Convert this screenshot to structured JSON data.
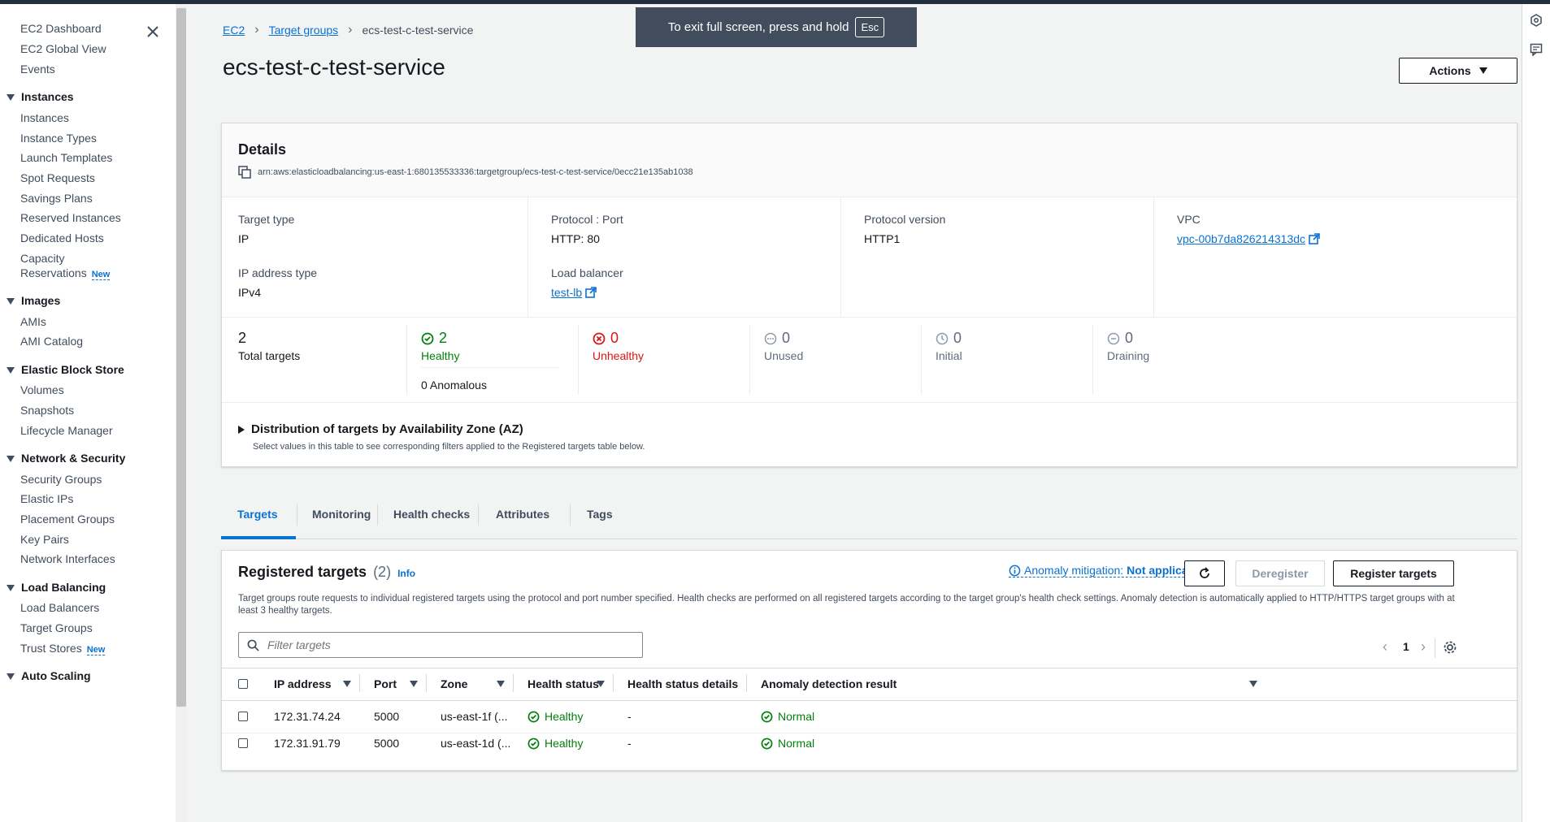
{
  "fullscreen_toast": {
    "text": "To exit full screen, press and hold",
    "key": "Esc"
  },
  "sidebar": {
    "top_items": [
      "EC2 Dashboard",
      "EC2 Global View",
      "Events"
    ],
    "sections": [
      {
        "title": "Instances",
        "items": [
          "Instances",
          "Instance Types",
          "Launch Templates",
          "Spot Requests",
          "Savings Plans",
          "Reserved Instances",
          "Dedicated Hosts",
          "Capacity",
          "Reservations"
        ]
      },
      {
        "title": "Images",
        "items": [
          "AMIs",
          "AMI Catalog"
        ]
      },
      {
        "title": "Elastic Block Store",
        "items": [
          "Volumes",
          "Snapshots",
          "Lifecycle Manager"
        ]
      },
      {
        "title": "Network & Security",
        "items": [
          "Security Groups",
          "Elastic IPs",
          "Placement Groups",
          "Key Pairs",
          "Network Interfaces"
        ]
      },
      {
        "title": "Load Balancing",
        "items": [
          "Load Balancers",
          "Target Groups",
          "Trust Stores"
        ]
      },
      {
        "title": "Auto Scaling",
        "items": []
      }
    ],
    "new_badge": "New"
  },
  "breadcrumb": {
    "items": [
      "EC2",
      "Target groups",
      "ecs-test-c-test-service"
    ]
  },
  "page_title": "ecs-test-c-test-service",
  "actions_label": "Actions",
  "details": {
    "title": "Details",
    "arn": "arn:aws:elasticloadbalancing:us-east-1:680135533336:targetgroup/ecs-test-c-test-service/0ecc21e135ab1038",
    "target_type": {
      "label": "Target type",
      "value": "IP"
    },
    "protocol_port": {
      "label": "Protocol : Port",
      "value": "HTTP: 80"
    },
    "protocol_version": {
      "label": "Protocol version",
      "value": "HTTP1"
    },
    "vpc": {
      "label": "VPC",
      "value": "vpc-00b7da826214313dc"
    },
    "ip_address_type": {
      "label": "IP address type",
      "value": "IPv4"
    },
    "load_balancer": {
      "label": "Load balancer",
      "value": "test-lb"
    },
    "stats": {
      "total": {
        "num": "2",
        "label": "Total targets"
      },
      "healthy": {
        "num": "2",
        "label": "Healthy",
        "sub": "0 Anomalous"
      },
      "unhealthy": {
        "num": "0",
        "label": "Unhealthy"
      },
      "unused": {
        "num": "0",
        "label": "Unused"
      },
      "initial": {
        "num": "0",
        "label": "Initial"
      },
      "draining": {
        "num": "0",
        "label": "Draining"
      }
    },
    "distribution": {
      "title": "Distribution of targets by Availability Zone (AZ)",
      "desc": "Select values in this table to see corresponding filters applied to the Registered targets table below."
    }
  },
  "tabs": [
    "Targets",
    "Monitoring",
    "Health checks",
    "Attributes",
    "Tags"
  ],
  "registered": {
    "title": "Registered targets",
    "count": "(2)",
    "info": "Info",
    "anomaly_label": "Anomaly mitigation:",
    "anomaly_value": "Not applicable",
    "deregister": "Deregister",
    "register": "Register targets",
    "desc": "Target groups route requests to individual registered targets using the protocol and port number specified. Health checks are performed on all registered targets according to the target group's health check settings. Anomaly detection is automatically applied to HTTP/HTTPS target groups with at least 3 healthy targets.",
    "filter_placeholder": "Filter targets",
    "page": "1",
    "columns": [
      "IP address",
      "Port",
      "Zone",
      "Health status",
      "Health status details",
      "Anomaly detection result"
    ],
    "rows": [
      {
        "ip": "172.31.74.24",
        "port": "5000",
        "zone": "us-east-1f (...",
        "health": "Healthy",
        "details": "-",
        "anomaly": "Normal"
      },
      {
        "ip": "172.31.91.79",
        "port": "5000",
        "zone": "us-east-1d (...",
        "health": "Healthy",
        "details": "-",
        "anomaly": "Normal"
      }
    ]
  }
}
